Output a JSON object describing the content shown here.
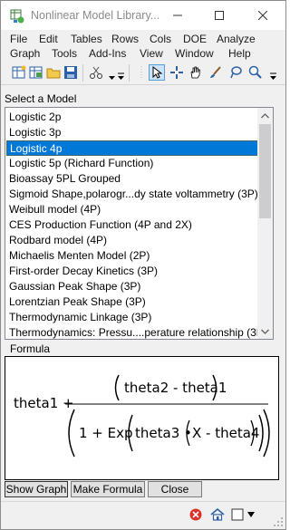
{
  "window": {
    "title": "Nonlinear Model Library..."
  },
  "menu": {
    "row1": [
      "File",
      "Edit",
      "Tables",
      "Rows",
      "Cols",
      "DOE",
      "Analyze"
    ],
    "row2": [
      "Graph",
      "Tools",
      "Add-Ins",
      "View",
      "Window",
      "Help"
    ]
  },
  "toolbar_icons": [
    "new-table-icon",
    "open-table-icon",
    "open-file-icon",
    "save-icon",
    "cut-icon",
    "arrow-tool-icon",
    "crosshair-tool-icon",
    "hand-tool-icon",
    "brush-tool-icon",
    "lasso-tool-icon",
    "magnifier-tool-icon"
  ],
  "model_list": {
    "label": "Select a Model",
    "items": [
      "Logistic 2p",
      "Logistic 3p",
      "Logistic 4p",
      "Logistic 5p (Richard Function)",
      "Bioassay 5PL Grouped",
      "Sigmoid Shape,polarogr...dy state voltammetry (3P)",
      "Weibull model (4P)",
      "CES Production Function (4P and 2X)",
      "Rodbard model (4P)",
      "Michaelis Menten Model (2P)",
      "First-order Decay Kinetics (3P)",
      "Gaussian Peak Shape (3P)",
      "Lorentzian Peak Shape (3P)",
      "Thermodynamic Linkage (3P)",
      "Thermodynamics: Pressu....perature relationship (3P)"
    ],
    "selected_index": 2
  },
  "formula": {
    "label": "Formula",
    "lead": "theta1 +",
    "numerator": "theta2 - theta1",
    "den_one": "1 + Exp",
    "den_theta3": "theta3 •",
    "den_inner": "X - theta4"
  },
  "buttons": {
    "show_graph": "Show Graph",
    "make_formula": "Make Formula",
    "close": "Close"
  },
  "colors": {
    "selection": "#0078d7",
    "window_bg": "#f0f0f0"
  }
}
